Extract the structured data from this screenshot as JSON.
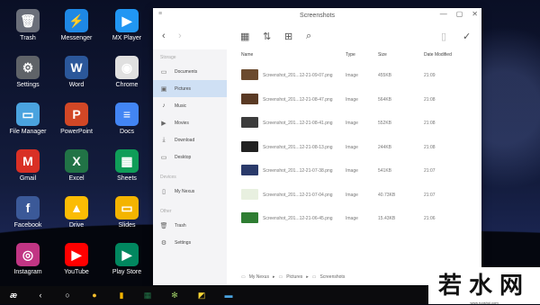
{
  "desktop": {
    "icons": [
      {
        "label": "Trash",
        "color": "#6b6f7a",
        "glyph": "🗑"
      },
      {
        "label": "Messenger",
        "color": "#1e88e5",
        "glyph": "⚡"
      },
      {
        "label": "MX Player",
        "color": "#2196f3",
        "glyph": "▶"
      },
      {
        "label": "Settings",
        "color": "#5f6368",
        "glyph": "⚙"
      },
      {
        "label": "Word",
        "color": "#2b579a",
        "glyph": "W"
      },
      {
        "label": "Chrome",
        "color": "#e0e0e0",
        "glyph": "◉"
      },
      {
        "label": "File Manager",
        "color": "#4aa3df",
        "glyph": "▭"
      },
      {
        "label": "PowerPoint",
        "color": "#d24726",
        "glyph": "P"
      },
      {
        "label": "Docs",
        "color": "#4285f4",
        "glyph": "≡"
      },
      {
        "label": "Gmail",
        "color": "#d93025",
        "glyph": "M"
      },
      {
        "label": "Excel",
        "color": "#217346",
        "glyph": "X"
      },
      {
        "label": "Sheets",
        "color": "#0f9d58",
        "glyph": "▦"
      },
      {
        "label": "Facebook",
        "color": "#3b5998",
        "glyph": "f"
      },
      {
        "label": "Drive",
        "color": "#fbbc04",
        "glyph": "▲"
      },
      {
        "label": "Slides",
        "color": "#f4b400",
        "glyph": "▭"
      },
      {
        "label": "Instagram",
        "color": "#c13584",
        "glyph": "◎"
      },
      {
        "label": "YouTube",
        "color": "#ff0000",
        "glyph": "▶"
      },
      {
        "label": "Play Store",
        "color": "#01875f",
        "glyph": "▶"
      }
    ]
  },
  "window": {
    "title": "Screenshots",
    "controls": {
      "minimize": "—",
      "maximize": "▢",
      "close": "✕"
    },
    "sidebar": {
      "section_storage": "Storage",
      "items": [
        {
          "label": "Documents",
          "icon": "▭"
        },
        {
          "label": "Pictures",
          "icon": "▣"
        },
        {
          "label": "Music",
          "icon": "♪"
        },
        {
          "label": "Movies",
          "icon": "▶"
        },
        {
          "label": "Download",
          "icon": "⤓"
        },
        {
          "label": "Desktop",
          "icon": "▭"
        }
      ],
      "section_devices": "Devices",
      "devices": [
        {
          "label": "My Nexus",
          "icon": "▯"
        }
      ],
      "section_other": "Other",
      "other": [
        {
          "label": "Trash",
          "icon": "🗑"
        },
        {
          "label": "Settings",
          "icon": "⚙"
        }
      ]
    },
    "table": {
      "headers": {
        "name": "Name",
        "type": "Type",
        "size": "Size",
        "date": "Date Modified"
      },
      "rows": [
        {
          "name": "Screenshot_201...12-21-09-07.png",
          "type": "Image",
          "size": "455KB",
          "date": "21:09",
          "thumb": "#6b4a2e"
        },
        {
          "name": "Screenshot_201...12-21-08-47.png",
          "type": "Image",
          "size": "564KB",
          "date": "21:08",
          "thumb": "#5a3a24"
        },
        {
          "name": "Screenshot_201...12-21-08-41.png",
          "type": "Image",
          "size": "552KB",
          "date": "21:08",
          "thumb": "#3c3c3c"
        },
        {
          "name": "Screenshot_201...12-21-08-13.png",
          "type": "Image",
          "size": "244KB",
          "date": "21:08",
          "thumb": "#222222"
        },
        {
          "name": "Screenshot_201...12-21-07-38.png",
          "type": "Image",
          "size": "541KB",
          "date": "21:07",
          "thumb": "#2a3a6a"
        },
        {
          "name": "Screenshot_201...12-21-07-04.png",
          "type": "Image",
          "size": "40.73KB",
          "date": "21:07",
          "thumb": "#e8f0e0"
        },
        {
          "name": "Screenshot_201...12-21-06-45.png",
          "type": "Image",
          "size": "15.43KB",
          "date": "21:06",
          "thumb": "#2e7d32"
        }
      ]
    },
    "breadcrumb": [
      "My Nexus",
      "Pictures",
      "Screenshots"
    ]
  },
  "watermark": {
    "text": "若水网",
    "sub": "www.ruoshui.com"
  }
}
